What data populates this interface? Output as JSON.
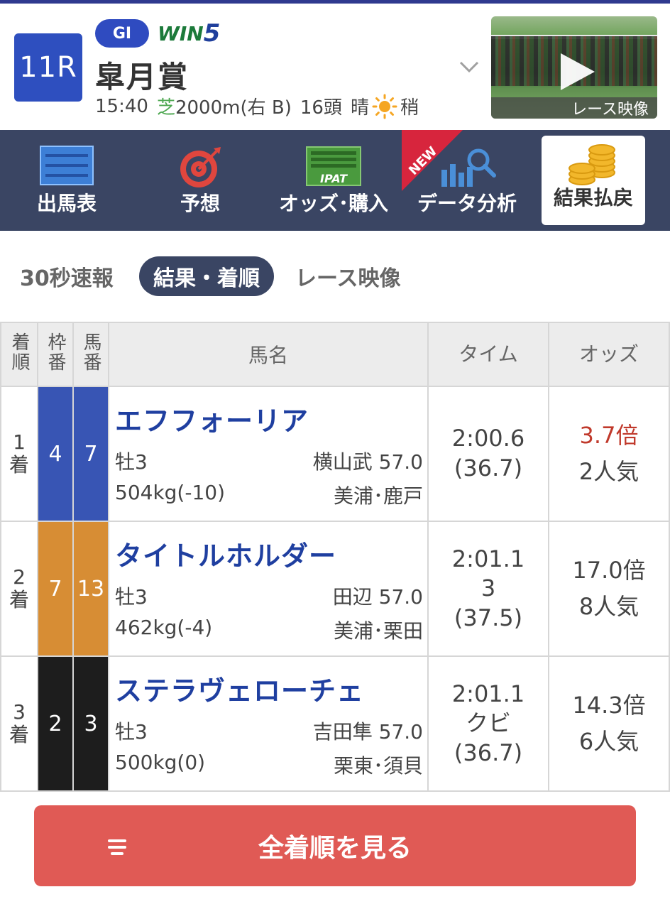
{
  "header": {
    "race_number": "11R",
    "grade": "GI",
    "win5_prefix": "WIN",
    "win5_suffix": "5",
    "race_name": "皐月賞",
    "time": "15:40",
    "surface": "芝",
    "distance": "2000m(右 B)",
    "runners": "16頭",
    "weather": "晴",
    "going": "稍",
    "video_label": "レース映像"
  },
  "nav": {
    "items": [
      {
        "label": "出馬表",
        "icon": "list-icon"
      },
      {
        "label": "予想",
        "icon": "target-icon"
      },
      {
        "label": "オッズ･購入",
        "icon": "ipat-icon"
      },
      {
        "label": "データ分析",
        "icon": "chart-search-icon"
      },
      {
        "label": "結果払戻",
        "icon": "coins-icon"
      }
    ],
    "new_badge": "NEW",
    "ipat_text": "IPAT"
  },
  "tabs": [
    {
      "label": "30秒速報",
      "active": false
    },
    {
      "label": "結果・着順",
      "active": true
    },
    {
      "label": "レース映像",
      "active": false
    }
  ],
  "table": {
    "headers": {
      "rank": "着順",
      "waku": "枠番",
      "uma": "馬番",
      "name": "馬名",
      "time": "タイム",
      "odds": "オッズ"
    },
    "rows": [
      {
        "rank_num": "1",
        "rank_suffix": "着",
        "waku": "4",
        "uma": "7",
        "name": "エフフォーリア",
        "sex_age": "牡3",
        "jockey_weight": "横山武 57.0",
        "body_weight": "504kg(-10)",
        "stable": "美浦･鹿戸",
        "time": "2:00.6",
        "margin": "",
        "last3f": "(36.7)",
        "odds": "3.7倍",
        "popularity": "2人気",
        "color": "#3855b4"
      },
      {
        "rank_num": "2",
        "rank_suffix": "着",
        "waku": "7",
        "uma": "13",
        "name": "タイトルホルダー",
        "sex_age": "牡3",
        "jockey_weight": "田辺 57.0",
        "body_weight": "462kg(-4)",
        "stable": "美浦･栗田",
        "time": "2:01.1",
        "margin": "3",
        "last3f": "(37.5)",
        "odds": "17.0倍",
        "popularity": "8人気",
        "color": "#d78d34"
      },
      {
        "rank_num": "3",
        "rank_suffix": "着",
        "waku": "2",
        "uma": "3",
        "name": "ステラヴェローチェ",
        "sex_age": "牡3",
        "jockey_weight": "吉田隼 57.0",
        "body_weight": "500kg(0)",
        "stable": "栗東･須貝",
        "time": "2:01.1",
        "margin": "クビ",
        "last3f": "(36.7)",
        "odds": "14.3倍",
        "popularity": "6人気",
        "color": "#1d1d1d"
      }
    ]
  },
  "button": {
    "label": "全着順を見る"
  },
  "colors": {
    "navy": "#3a4563",
    "blue": "#2e4fbf",
    "red_button": "#e05a55",
    "odds_red": "#c0392b",
    "horse_name": "#1f3fa0"
  }
}
